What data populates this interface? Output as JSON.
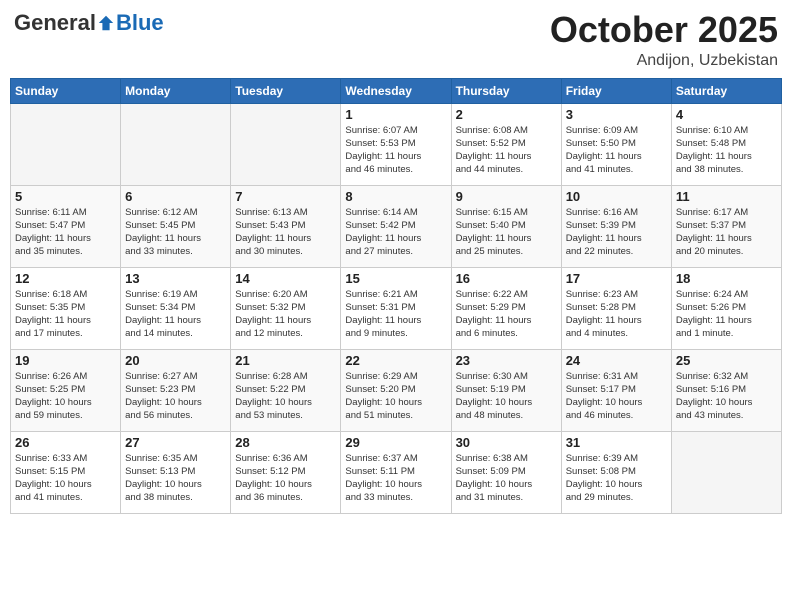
{
  "header": {
    "logo_general": "General",
    "logo_blue": "Blue",
    "month_title": "October 2025",
    "location": "Andijon, Uzbekistan"
  },
  "weekdays": [
    "Sunday",
    "Monday",
    "Tuesday",
    "Wednesday",
    "Thursday",
    "Friday",
    "Saturday"
  ],
  "weeks": [
    [
      {
        "day": "",
        "info": ""
      },
      {
        "day": "",
        "info": ""
      },
      {
        "day": "",
        "info": ""
      },
      {
        "day": "1",
        "info": "Sunrise: 6:07 AM\nSunset: 5:53 PM\nDaylight: 11 hours\nand 46 minutes."
      },
      {
        "day": "2",
        "info": "Sunrise: 6:08 AM\nSunset: 5:52 PM\nDaylight: 11 hours\nand 44 minutes."
      },
      {
        "day": "3",
        "info": "Sunrise: 6:09 AM\nSunset: 5:50 PM\nDaylight: 11 hours\nand 41 minutes."
      },
      {
        "day": "4",
        "info": "Sunrise: 6:10 AM\nSunset: 5:48 PM\nDaylight: 11 hours\nand 38 minutes."
      }
    ],
    [
      {
        "day": "5",
        "info": "Sunrise: 6:11 AM\nSunset: 5:47 PM\nDaylight: 11 hours\nand 35 minutes."
      },
      {
        "day": "6",
        "info": "Sunrise: 6:12 AM\nSunset: 5:45 PM\nDaylight: 11 hours\nand 33 minutes."
      },
      {
        "day": "7",
        "info": "Sunrise: 6:13 AM\nSunset: 5:43 PM\nDaylight: 11 hours\nand 30 minutes."
      },
      {
        "day": "8",
        "info": "Sunrise: 6:14 AM\nSunset: 5:42 PM\nDaylight: 11 hours\nand 27 minutes."
      },
      {
        "day": "9",
        "info": "Sunrise: 6:15 AM\nSunset: 5:40 PM\nDaylight: 11 hours\nand 25 minutes."
      },
      {
        "day": "10",
        "info": "Sunrise: 6:16 AM\nSunset: 5:39 PM\nDaylight: 11 hours\nand 22 minutes."
      },
      {
        "day": "11",
        "info": "Sunrise: 6:17 AM\nSunset: 5:37 PM\nDaylight: 11 hours\nand 20 minutes."
      }
    ],
    [
      {
        "day": "12",
        "info": "Sunrise: 6:18 AM\nSunset: 5:35 PM\nDaylight: 11 hours\nand 17 minutes."
      },
      {
        "day": "13",
        "info": "Sunrise: 6:19 AM\nSunset: 5:34 PM\nDaylight: 11 hours\nand 14 minutes."
      },
      {
        "day": "14",
        "info": "Sunrise: 6:20 AM\nSunset: 5:32 PM\nDaylight: 11 hours\nand 12 minutes."
      },
      {
        "day": "15",
        "info": "Sunrise: 6:21 AM\nSunset: 5:31 PM\nDaylight: 11 hours\nand 9 minutes."
      },
      {
        "day": "16",
        "info": "Sunrise: 6:22 AM\nSunset: 5:29 PM\nDaylight: 11 hours\nand 6 minutes."
      },
      {
        "day": "17",
        "info": "Sunrise: 6:23 AM\nSunset: 5:28 PM\nDaylight: 11 hours\nand 4 minutes."
      },
      {
        "day": "18",
        "info": "Sunrise: 6:24 AM\nSunset: 5:26 PM\nDaylight: 11 hours\nand 1 minute."
      }
    ],
    [
      {
        "day": "19",
        "info": "Sunrise: 6:26 AM\nSunset: 5:25 PM\nDaylight: 10 hours\nand 59 minutes."
      },
      {
        "day": "20",
        "info": "Sunrise: 6:27 AM\nSunset: 5:23 PM\nDaylight: 10 hours\nand 56 minutes."
      },
      {
        "day": "21",
        "info": "Sunrise: 6:28 AM\nSunset: 5:22 PM\nDaylight: 10 hours\nand 53 minutes."
      },
      {
        "day": "22",
        "info": "Sunrise: 6:29 AM\nSunset: 5:20 PM\nDaylight: 10 hours\nand 51 minutes."
      },
      {
        "day": "23",
        "info": "Sunrise: 6:30 AM\nSunset: 5:19 PM\nDaylight: 10 hours\nand 48 minutes."
      },
      {
        "day": "24",
        "info": "Sunrise: 6:31 AM\nSunset: 5:17 PM\nDaylight: 10 hours\nand 46 minutes."
      },
      {
        "day": "25",
        "info": "Sunrise: 6:32 AM\nSunset: 5:16 PM\nDaylight: 10 hours\nand 43 minutes."
      }
    ],
    [
      {
        "day": "26",
        "info": "Sunrise: 6:33 AM\nSunset: 5:15 PM\nDaylight: 10 hours\nand 41 minutes."
      },
      {
        "day": "27",
        "info": "Sunrise: 6:35 AM\nSunset: 5:13 PM\nDaylight: 10 hours\nand 38 minutes."
      },
      {
        "day": "28",
        "info": "Sunrise: 6:36 AM\nSunset: 5:12 PM\nDaylight: 10 hours\nand 36 minutes."
      },
      {
        "day": "29",
        "info": "Sunrise: 6:37 AM\nSunset: 5:11 PM\nDaylight: 10 hours\nand 33 minutes."
      },
      {
        "day": "30",
        "info": "Sunrise: 6:38 AM\nSunset: 5:09 PM\nDaylight: 10 hours\nand 31 minutes."
      },
      {
        "day": "31",
        "info": "Sunrise: 6:39 AM\nSunset: 5:08 PM\nDaylight: 10 hours\nand 29 minutes."
      },
      {
        "day": "",
        "info": ""
      }
    ]
  ]
}
